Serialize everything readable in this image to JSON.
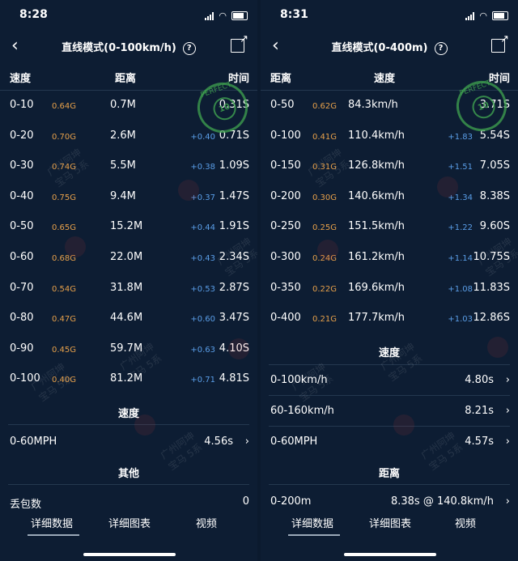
{
  "left": {
    "status_time": "8:28",
    "title": "直线模式(0-100km/h)",
    "headers": [
      "速度",
      "距离",
      "时间"
    ],
    "rows": [
      {
        "range": "0-10",
        "g": "0.64G",
        "value": "0.7M",
        "delta": "",
        "time": "0.31S"
      },
      {
        "range": "0-20",
        "g": "0.70G",
        "value": "2.6M",
        "delta": "+0.40",
        "time": "0.71S"
      },
      {
        "range": "0-30",
        "g": "0.74G",
        "value": "5.5M",
        "delta": "+0.38",
        "time": "1.09S"
      },
      {
        "range": "0-40",
        "g": "0.75G",
        "value": "9.4M",
        "delta": "+0.37",
        "time": "1.47S"
      },
      {
        "range": "0-50",
        "g": "0.65G",
        "value": "15.2M",
        "delta": "+0.44",
        "time": "1.91S"
      },
      {
        "range": "0-60",
        "g": "0.68G",
        "value": "22.0M",
        "delta": "+0.43",
        "time": "2.34S"
      },
      {
        "range": "0-70",
        "g": "0.54G",
        "value": "31.8M",
        "delta": "+0.53",
        "time": "2.87S"
      },
      {
        "range": "0-80",
        "g": "0.47G",
        "value": "44.6M",
        "delta": "+0.60",
        "time": "3.47S"
      },
      {
        "range": "0-90",
        "g": "0.45G",
        "value": "59.7M",
        "delta": "+0.63",
        "time": "4.10S"
      },
      {
        "range": "0-100",
        "g": "0.40G",
        "value": "81.2M",
        "delta": "+0.71",
        "time": "4.81S"
      }
    ],
    "section_speed": "速度",
    "summary_speed": [
      {
        "label": "0-60MPH",
        "value": "4.56s"
      }
    ],
    "section_other": "其他",
    "other": [
      {
        "label": "丢包数",
        "value": "0"
      }
    ],
    "tabs": [
      "详细数据",
      "详细图表",
      "视频"
    ]
  },
  "right": {
    "status_time": "8:31",
    "title": "直线模式(0-400m)",
    "headers": [
      "距离",
      "速度",
      "时间"
    ],
    "rows": [
      {
        "range": "0-50",
        "g": "0.62G",
        "value": "84.3km/h",
        "delta": "",
        "time": "3.71S"
      },
      {
        "range": "0-100",
        "g": "0.41G",
        "value": "110.4km/h",
        "delta": "+1.83",
        "time": "5.54S"
      },
      {
        "range": "0-150",
        "g": "0.31G",
        "value": "126.8km/h",
        "delta": "+1.51",
        "time": "7.05S"
      },
      {
        "range": "0-200",
        "g": "0.30G",
        "value": "140.6km/h",
        "delta": "+1.34",
        "time": "8.38S"
      },
      {
        "range": "0-250",
        "g": "0.25G",
        "value": "151.5km/h",
        "delta": "+1.22",
        "time": "9.60S"
      },
      {
        "range": "0-300",
        "g": "0.24G",
        "value": "161.2km/h",
        "delta": "+1.14",
        "time": "10.75S"
      },
      {
        "range": "0-350",
        "g": "0.22G",
        "value": "169.6km/h",
        "delta": "+1.08",
        "time": "11.83S"
      },
      {
        "range": "0-400",
        "g": "0.21G",
        "value": "177.7km/h",
        "delta": "+1.03",
        "time": "12.86S"
      }
    ],
    "section_speed": "速度",
    "summary_speed": [
      {
        "label": "0-100km/h",
        "value": "4.80s"
      },
      {
        "label": "60-160km/h",
        "value": "8.21s"
      },
      {
        "label": "0-60MPH",
        "value": "4.57s"
      }
    ],
    "section_distance": "距离",
    "summary_distance": [
      {
        "label": "0-200m",
        "value": "8.38s @ 140.8km/h"
      }
    ],
    "tabs": [
      "详细数据",
      "详细图表",
      "视频"
    ]
  },
  "watermark": {
    "line1": "广州阿坤",
    "line2": "宝马 5系"
  },
  "stamp": {
    "text": "PERFECT",
    "number": "10"
  },
  "colors": {
    "g_value": "#e6a04a",
    "delta": "#5a9ee8",
    "stamp": "#40a450",
    "bg": "#0d1d33"
  }
}
